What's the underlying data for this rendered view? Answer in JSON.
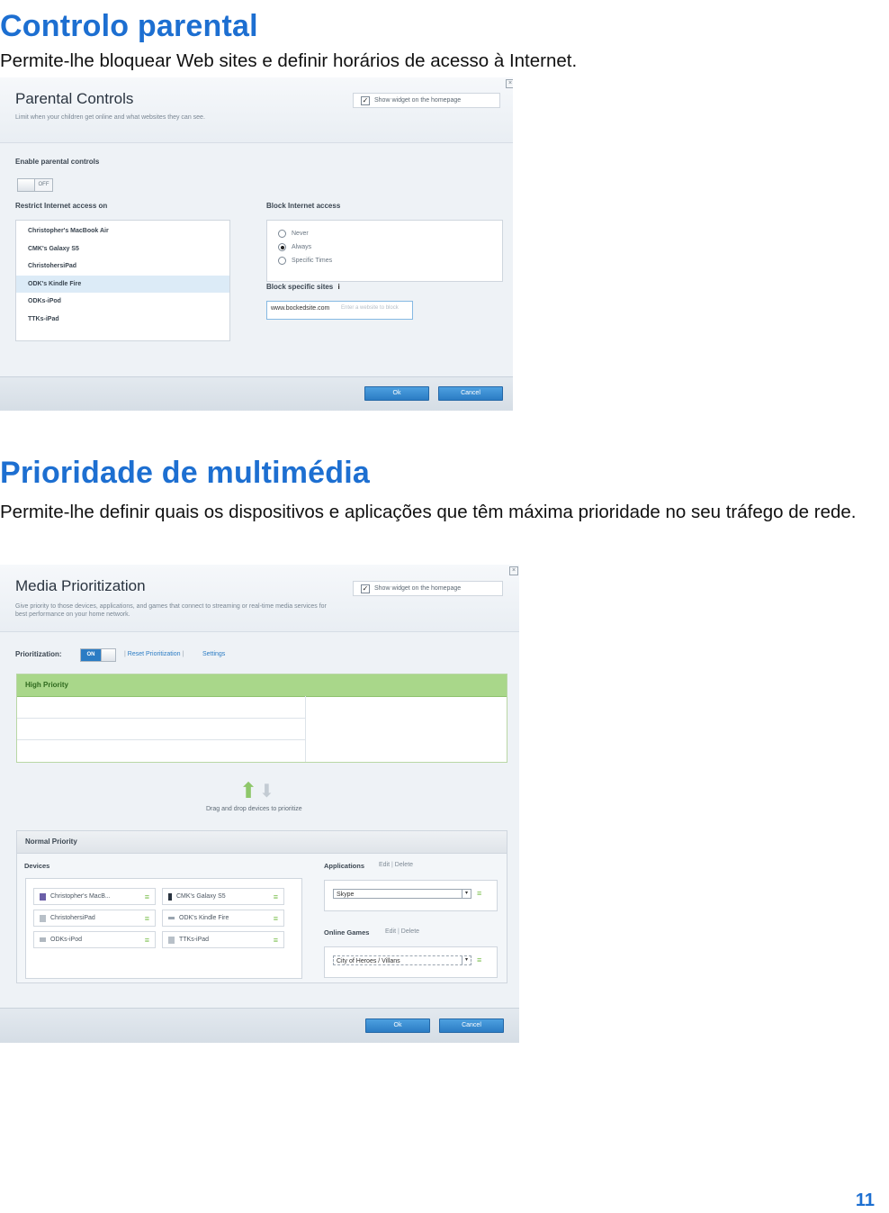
{
  "section1": {
    "heading": "Controlo parental",
    "description": "Permite-lhe bloquear Web sites e definir horários de acesso à Internet."
  },
  "parental": {
    "title": "Parental Controls",
    "subtitle": "Limit when your children get online and what websites they can see.",
    "widget_label": "Show widget on the homepage",
    "enable_label": "Enable parental controls",
    "toggle_state": "OFF",
    "restrict_label": "Restrict Internet access on",
    "devices": [
      "Christopher's MacBook Air",
      "CMK's Galaxy S5",
      "ChristohersiPad",
      "ODK's Kindle Fire",
      "ODKs-iPod",
      "TTKs-iPad"
    ],
    "selected_device_index": 3,
    "block_label": "Block Internet access",
    "block_options": [
      "Never",
      "Always",
      "Specific Times"
    ],
    "block_selected_index": 1,
    "block_sites_label": "Block specific sites",
    "site_value": "www.bockedsite.com",
    "site_placeholder": "Enter a website to block",
    "ok": "Ok",
    "cancel": "Cancel"
  },
  "section2": {
    "heading": "Prioridade de multimédia",
    "description": "Permite-lhe definir quais os dispositivos e aplicações que têm máxima prioridade no seu tráfego de rede."
  },
  "media": {
    "title": "Media Prioritization",
    "subtitle": "Give priority to those devices, applications, and games that connect to streaming or real-time media services for best performance on your home network.",
    "widget_label": "Show widget on the homepage",
    "prioritization_label": "Prioritization:",
    "toggle_state": "ON",
    "reset_link": "Reset Prioritization",
    "settings_link": "Settings",
    "high_priority": "High Priority",
    "drag_hint": "Drag and drop devices to prioritize",
    "normal_priority": "Normal Priority",
    "devices_label": "Devices",
    "devices": [
      "Christopher's MacB...",
      "CMK's Galaxy S5",
      "ChristohersiPad",
      "ODK's Kindle Fire",
      "ODKs-iPod",
      "TTKs-iPad"
    ],
    "applications_label": "Applications",
    "edit": "Edit",
    "delete": "Delete",
    "application_value": "Skype",
    "games_label": "Online Games",
    "game_value": "City of Heroes / Villans",
    "ok": "Ok",
    "cancel": "Cancel"
  },
  "page_number": "11"
}
